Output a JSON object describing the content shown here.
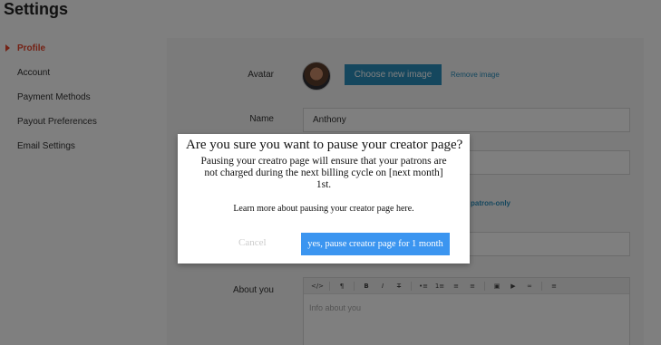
{
  "page": {
    "title": "Settings"
  },
  "sidebar": {
    "items": [
      {
        "label": "Profile",
        "active": true
      },
      {
        "label": "Account"
      },
      {
        "label": "Payment Methods"
      },
      {
        "label": "Payout Preferences"
      },
      {
        "label": "Email Settings"
      }
    ]
  },
  "profile": {
    "avatar_label": "Avatar",
    "choose_image_label": "Choose new image",
    "remove_image_label": "Remove image",
    "name_label": "Name",
    "name_value": "Anthony",
    "patron_only_link": "patron-only",
    "about_label": "About you",
    "about_placeholder": "Info about you"
  },
  "editor_toolbar": {
    "buttons": [
      "</>",
      "¶",
      "B",
      "I",
      "T",
      "•≡",
      "1≡",
      "≡",
      "≡",
      "▣",
      "▶",
      "∞",
      "≡"
    ]
  },
  "modal": {
    "title": "Are you sure you want to pause your creator page?",
    "body": "Pausing your creatro page will ensure that your patrons are not charged during the next billing cycle on [next month] 1st.",
    "link": "Learn more about pausing your creator page here.",
    "cancel_label": "Cancel",
    "confirm_label": "yes, pause creator page for 1 month"
  },
  "colors": {
    "accent_red": "#e8442a",
    "primary_blue": "#2a8fbd",
    "confirm_blue": "#3b95f0",
    "overlay": "rgba(0,0,0,0.5)"
  }
}
